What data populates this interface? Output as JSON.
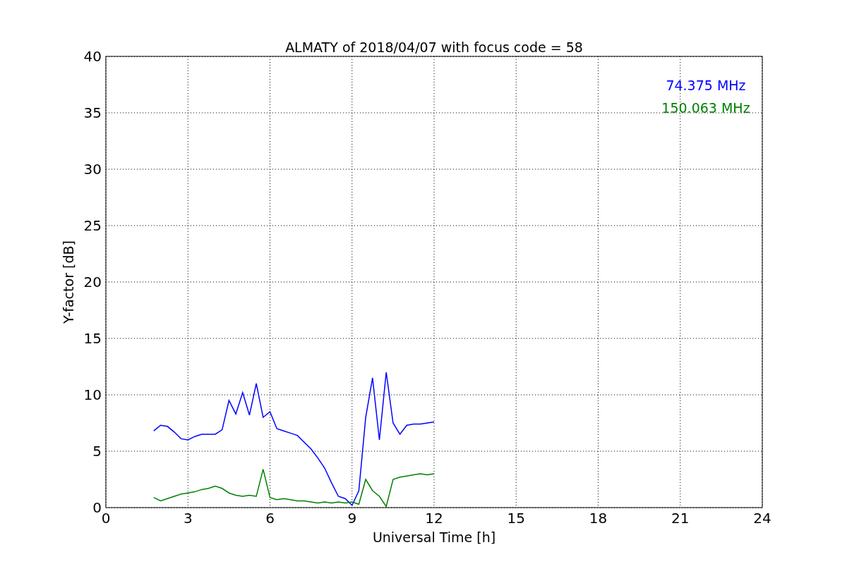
{
  "chart_data": {
    "type": "line",
    "title": "ALMATY of 2018/04/07 with focus code = 58",
    "xlabel": "Universal Time [h]",
    "ylabel": "Y-factor [dB]",
    "x": [
      1.75,
      2,
      2.25,
      2.5,
      2.75,
      3,
      3.25,
      3.5,
      3.75,
      4,
      4.25,
      4.5,
      4.75,
      5,
      5.25,
      5.5,
      5.75,
      6,
      6.25,
      6.5,
      6.75,
      7,
      7.25,
      7.5,
      7.75,
      8,
      8.25,
      8.5,
      8.75,
      9,
      9.25,
      9.5,
      9.75,
      10,
      10.25,
      10.5,
      10.75,
      11,
      11.25,
      11.5,
      11.75,
      12
    ],
    "series": [
      {
        "name": "74.375 MHz",
        "color": "#0000ff",
        "values": [
          6.8,
          7.3,
          7.2,
          6.7,
          6.1,
          6.0,
          6.3,
          6.5,
          6.5,
          6.5,
          6.9,
          9.5,
          8.3,
          10.2,
          8.2,
          11.0,
          8.0,
          8.5,
          7.0,
          6.8,
          6.6,
          6.4,
          5.8,
          5.2,
          4.4,
          3.5,
          2.2,
          1.0,
          0.8,
          0.2,
          1.5,
          8.0,
          11.5,
          6.0,
          12.0,
          7.5,
          6.5,
          7.3,
          7.4,
          7.4,
          7.5,
          7.6
        ]
      },
      {
        "name": "150.063 MHz",
        "color": "#008000",
        "values": [
          0.9,
          0.6,
          0.8,
          1.0,
          1.2,
          1.3,
          1.4,
          1.6,
          1.7,
          1.9,
          1.7,
          1.3,
          1.1,
          1.0,
          1.1,
          1.0,
          3.4,
          0.9,
          0.7,
          0.8,
          0.7,
          0.6,
          0.6,
          0.5,
          0.4,
          0.5,
          0.4,
          0.5,
          0.4,
          0.5,
          0.3,
          2.5,
          1.5,
          1.0,
          0.1,
          2.5,
          2.7,
          2.8,
          2.9,
          3.0,
          2.9,
          3.0
        ]
      }
    ],
    "xlim": [
      0,
      24
    ],
    "ylim": [
      0,
      40
    ],
    "xticks": [
      0,
      3,
      6,
      9,
      12,
      15,
      18,
      21,
      24
    ],
    "yticks": [
      0,
      5,
      10,
      15,
      20,
      25,
      30,
      35,
      40
    ],
    "grid": true
  }
}
